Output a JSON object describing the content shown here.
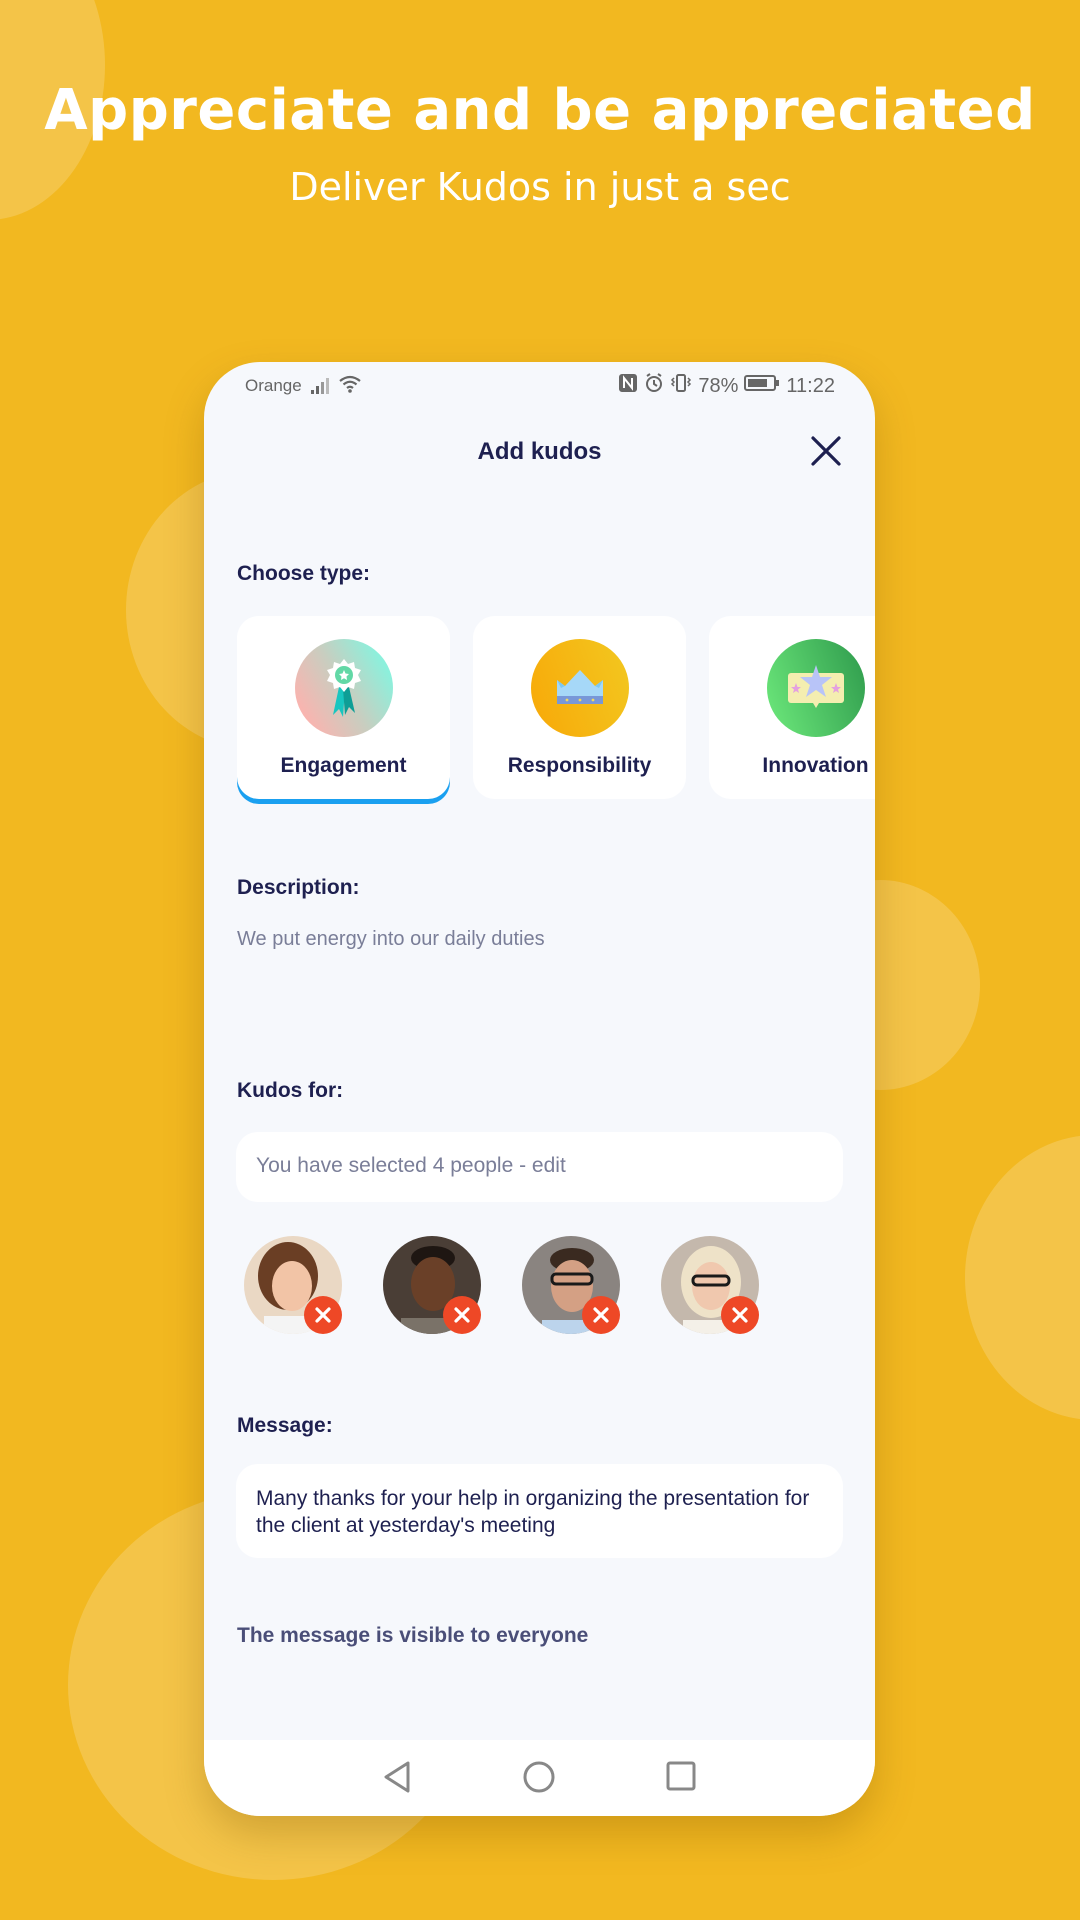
{
  "hero": {
    "title": "Appreciate and be appreciated",
    "subtitle": "Deliver Kudos in just a sec"
  },
  "statusbar": {
    "carrier": "Orange",
    "battery": "78%",
    "time": "11:22",
    "icons": [
      "signal-icon",
      "wifi-icon",
      "nfc-icon",
      "alarm-icon",
      "vibrate-icon",
      "battery-icon"
    ]
  },
  "header": {
    "title": "Add kudos",
    "close_icon": "close-icon"
  },
  "type_section": {
    "label": "Choose type:",
    "selected": "Engagement",
    "types": [
      {
        "label": "Engagement",
        "icon": "rosette-icon"
      },
      {
        "label": "Responsibility",
        "icon": "crown-icon"
      },
      {
        "label": "Innovation",
        "icon": "star-message-icon"
      }
    ]
  },
  "description": {
    "label": "Description:",
    "text": "We put energy into our daily duties"
  },
  "kudos_for": {
    "label": "Kudos for:",
    "field_text": "You have selected 4 people - edit",
    "people_count": 4
  },
  "message": {
    "label": "Message:",
    "text": "Many thanks for your help in organizing the presentation for the client at yesterday's meeting"
  },
  "visibility_note": "The message is visible to everyone",
  "navbar": {
    "icons": [
      "back-icon",
      "home-icon",
      "recents-icon"
    ]
  },
  "colors": {
    "background": "#F2B820",
    "primary_text": "#1E2050",
    "secondary_text": "#7A7E98",
    "selected_accent": "#1AA0F0",
    "remove": "#EE4826"
  }
}
